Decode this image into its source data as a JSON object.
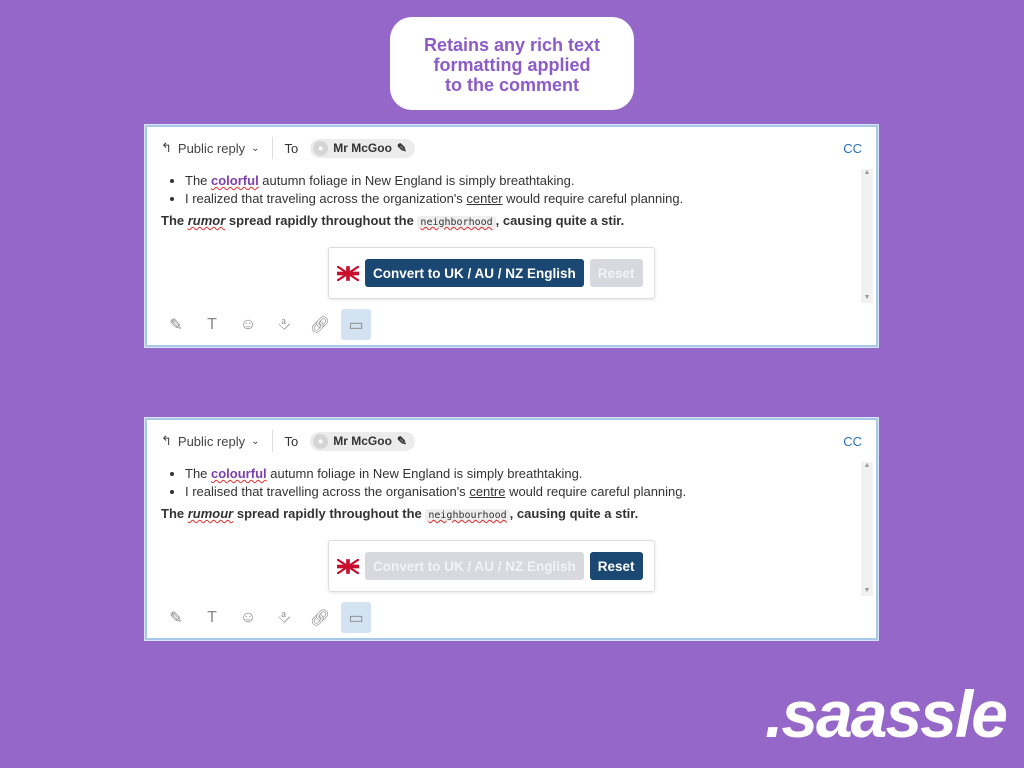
{
  "callout": {
    "lines": [
      "Retains any rich text",
      "formatting applied",
      "to the comment"
    ]
  },
  "logo": ".saassle",
  "colors": {
    "background": "#9567c9",
    "primary_button": "#1a4873",
    "highlight": "#7d3fb0"
  },
  "panels": [
    {
      "reply": "Public reply",
      "to": "To",
      "recipient": "Mr McGoo",
      "cc": "CC",
      "b1": [
        "The ",
        "colorful",
        " autumn foliage in New England is simply breathtaking."
      ],
      "b2": [
        "I realized that traveling across the organization's ",
        "center",
        " would require careful planning."
      ],
      "p": [
        "The ",
        "rumor",
        " spread rapidly throughout the ",
        "neighborhood",
        ", causing quite a stir."
      ],
      "convert": "Convert to UK / AU / NZ English",
      "reset": "Reset",
      "active": "convert"
    },
    {
      "reply": "Public reply",
      "to": "To",
      "recipient": "Mr McGoo",
      "cc": "CC",
      "b1": [
        "The ",
        "colourful",
        " autumn foliage in New England is simply breathtaking."
      ],
      "b2": [
        "I realised that travelling across the organisation's ",
        "centre",
        " would require careful planning."
      ],
      "p": [
        "The ",
        "rumour",
        " spread rapidly throughout the ",
        "neighbourhood",
        ", causing quite a stir."
      ],
      "convert": "Convert to UK / AU / NZ English",
      "reset": "Reset",
      "active": "reset"
    }
  ]
}
